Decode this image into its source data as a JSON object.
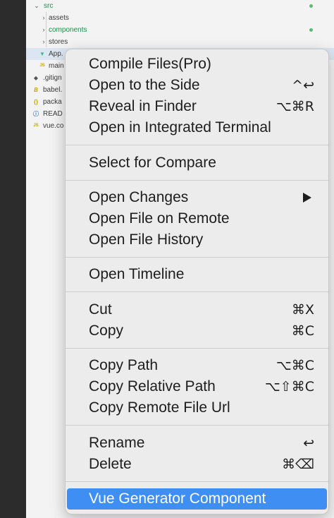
{
  "explorer": {
    "items": [
      {
        "label": "src",
        "chevron": "⌄",
        "icon": "",
        "color": "#1e8f4d"
      },
      {
        "label": "assets",
        "chevron": "›",
        "icon": "",
        "color": "#3b3b3b"
      },
      {
        "label": "components",
        "chevron": "›",
        "icon": "",
        "color": "#1e8f4d"
      },
      {
        "label": "stores",
        "chevron": "›",
        "icon": "",
        "color": "#3b3b3b"
      },
      {
        "label": "App.",
        "chevron": "",
        "icon": "▼",
        "color": "#3b3b3b"
      },
      {
        "label": "main",
        "chevron": "",
        "icon": "JS",
        "color": "#3b3b3b"
      },
      {
        "label": ".gitign",
        "chevron": "",
        "icon": "◆",
        "color": "#3b3b3b"
      },
      {
        "label": "babel.",
        "chevron": "",
        "icon": "B",
        "color": "#3b3b3b"
      },
      {
        "label": "packa",
        "chevron": "",
        "icon": "{}",
        "color": "#3b3b3b"
      },
      {
        "label": "READ",
        "chevron": "",
        "icon": "ⓘ",
        "color": "#3b3b3b"
      },
      {
        "label": "vue.co",
        "chevron": "",
        "icon": "JS",
        "color": "#3b3b3b"
      }
    ]
  },
  "menu": {
    "items": [
      {
        "label": "Compile Files(Pro)",
        "shortcut": ""
      },
      {
        "label": "Open to the Side",
        "shortcut": "^↩"
      },
      {
        "label": "Reveal in Finder",
        "shortcut": "⌥⌘R"
      },
      {
        "label": "Open in Integrated Terminal",
        "shortcut": ""
      },
      {
        "label": "Select for Compare",
        "shortcut": ""
      },
      {
        "label": "Open Changes",
        "shortcut": ""
      },
      {
        "label": "Open File on Remote",
        "shortcut": ""
      },
      {
        "label": "Open File History",
        "shortcut": ""
      },
      {
        "label": "Open Timeline",
        "shortcut": ""
      },
      {
        "label": "Cut",
        "shortcut": "⌘X"
      },
      {
        "label": "Copy",
        "shortcut": "⌘C"
      },
      {
        "label": "Copy Path",
        "shortcut": "⌥⌘C"
      },
      {
        "label": "Copy Relative Path",
        "shortcut": "⌥⇧⌘C"
      },
      {
        "label": "Copy Remote File Url",
        "shortcut": ""
      },
      {
        "label": "Rename",
        "shortcut": "↩"
      },
      {
        "label": "Delete",
        "shortcut": "⌘⌫"
      },
      {
        "label": "Vue Generator Component",
        "shortcut": ""
      }
    ]
  },
  "colors": {
    "highlight": "#3f8ef3",
    "git_added": "#5fb878",
    "folder_modified": "#1e8f4d"
  }
}
